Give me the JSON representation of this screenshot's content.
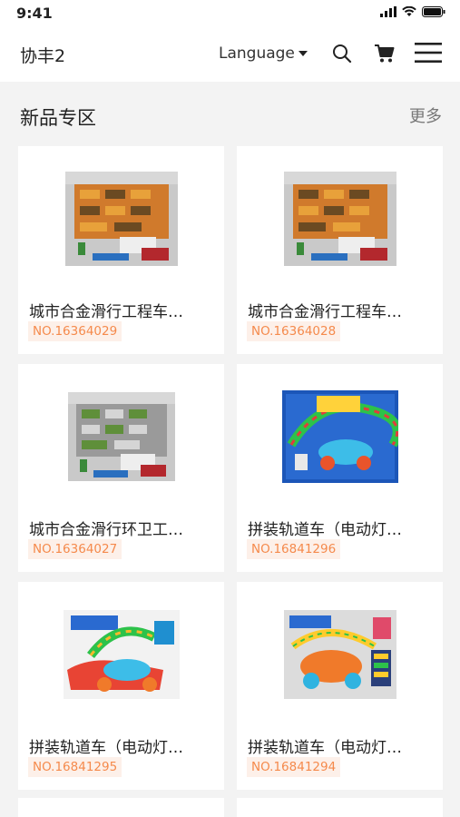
{
  "status": {
    "time": "9:41"
  },
  "header": {
    "title": "协丰2",
    "language_label": "Language"
  },
  "section": {
    "title": "新品专区",
    "more_label": "更多"
  },
  "products": [
    {
      "name": "城市合金滑行工程车…",
      "code": "NO.16364029",
      "image": "construction-vehicle-box"
    },
    {
      "name": "城市合金滑行工程车…",
      "code": "NO.16364028",
      "image": "construction-vehicle-box"
    },
    {
      "name": "城市合金滑行环卫工…",
      "code": "NO.16364027",
      "image": "sanitation-vehicle-box"
    },
    {
      "name": "拼装轨道车（电动灯…",
      "code": "NO.16841296",
      "image": "track-car-box-blue"
    },
    {
      "name": "拼装轨道车（电动灯…",
      "code": "NO.16841295",
      "image": "track-car-box-white"
    },
    {
      "name": "拼装轨道车（电动灯…",
      "code": "NO.16841294",
      "image": "track-car-box-orange"
    }
  ],
  "colors": {
    "accent": "#f58a4c",
    "code_bg": "#fdf0e9",
    "page_bg": "#f3f3f3"
  }
}
